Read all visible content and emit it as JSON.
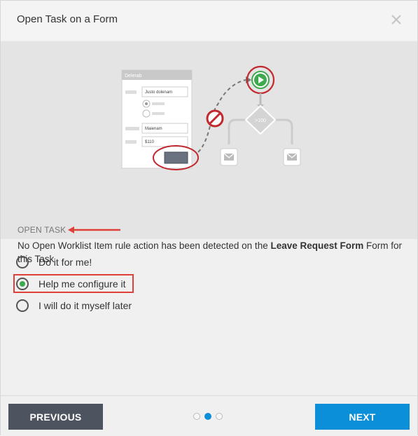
{
  "dialog": {
    "title": "Open Task on a Form"
  },
  "illustration": {
    "form_title": "Delerab",
    "field1_value": "Justo dolenam",
    "field2_value": "Maienam",
    "field3_value": "$110",
    "decision_label": ">100"
  },
  "info": {
    "heading": "OPEN TASK",
    "desc_prefix": "No Open Worklist Item rule action has been detected on the ",
    "form_name": "Leave Request Form",
    "desc_suffix": " Form for this Task"
  },
  "options": [
    {
      "label": "Do it for me!",
      "selected": false
    },
    {
      "label": "Help me configure it",
      "selected": true
    },
    {
      "label": "I will do it myself later",
      "selected": false
    }
  ],
  "footer": {
    "previous_label": "PREVIOUS",
    "next_label": "NEXT",
    "pages": 3,
    "current_page": 2
  },
  "colors": {
    "accent": "#0a8fd8",
    "selected_radio": "#3eaa4d",
    "highlight": "#e0403a",
    "prev_button": "#4d5460"
  }
}
